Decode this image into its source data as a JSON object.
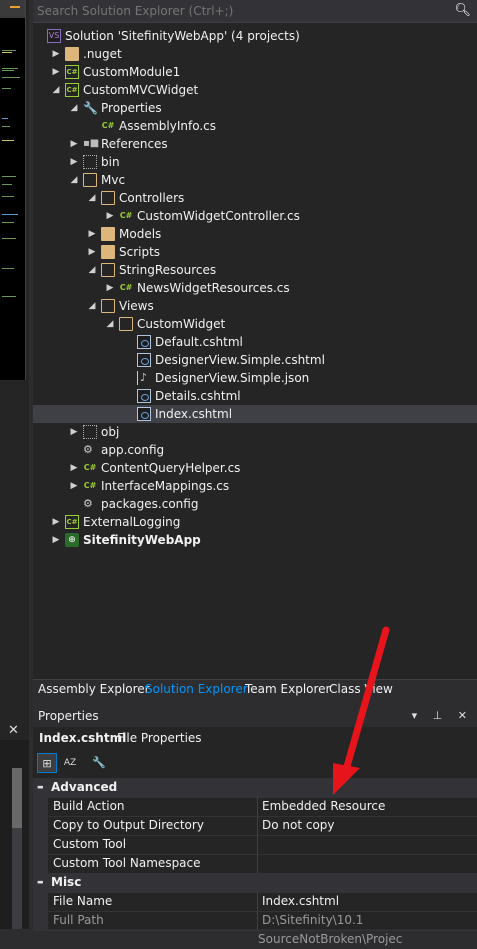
{
  "search": {
    "placeholder": "Search Solution Explorer (Ctrl+;)"
  },
  "tree": [
    {
      "label": "Solution 'SitefinityWebApp' (4 projects)",
      "indent": 0,
      "arrow": "",
      "icon": "vs-sol",
      "iconText": "VS",
      "bold": false
    },
    {
      "label": ".nuget",
      "indent": 1,
      "arrow": "▶",
      "icon": "folder",
      "bold": false
    },
    {
      "label": "CustomModule1",
      "indent": 1,
      "arrow": "▶",
      "icon": "cs-proj",
      "iconText": "C#",
      "bold": false
    },
    {
      "label": "CustomMVCWidget",
      "indent": 1,
      "arrow": "◢",
      "icon": "cs-proj",
      "iconText": "C#",
      "bold": false
    },
    {
      "label": "Properties",
      "indent": 2,
      "arrow": "◢",
      "icon": "wrench",
      "iconText": "🔧",
      "bold": false
    },
    {
      "label": "AssemblyInfo.cs",
      "indent": 3,
      "arrow": "",
      "icon": "cs-file",
      "iconText": "C#",
      "bold": false
    },
    {
      "label": "References",
      "indent": 2,
      "arrow": "▶",
      "icon": "refs",
      "iconText": "▪■",
      "bold": false
    },
    {
      "label": "bin",
      "indent": 2,
      "arrow": "▶",
      "icon": "folder-dots",
      "bold": false
    },
    {
      "label": "Mvc",
      "indent": 2,
      "arrow": "◢",
      "icon": "folder open",
      "bold": false
    },
    {
      "label": "Controllers",
      "indent": 3,
      "arrow": "◢",
      "icon": "folder open",
      "bold": false
    },
    {
      "label": "CustomWidgetController.cs",
      "indent": 4,
      "arrow": "▶",
      "icon": "cs-file",
      "iconText": "C#",
      "bold": false
    },
    {
      "label": "Models",
      "indent": 3,
      "arrow": "▶",
      "icon": "folder",
      "bold": false
    },
    {
      "label": "Scripts",
      "indent": 3,
      "arrow": "▶",
      "icon": "folder",
      "bold": false
    },
    {
      "label": "StringResources",
      "indent": 3,
      "arrow": "◢",
      "icon": "folder open",
      "bold": false
    },
    {
      "label": "NewsWidgetResources.cs",
      "indent": 4,
      "arrow": "▶",
      "icon": "cs-file",
      "iconText": "C#",
      "bold": false
    },
    {
      "label": "Views",
      "indent": 3,
      "arrow": "◢",
      "icon": "folder open",
      "bold": false
    },
    {
      "label": "CustomWidget",
      "indent": 4,
      "arrow": "◢",
      "icon": "folder open",
      "bold": false
    },
    {
      "label": "Default.cshtml",
      "indent": 5,
      "arrow": "",
      "icon": "file-doc",
      "bold": false
    },
    {
      "label": "DesignerView.Simple.cshtml",
      "indent": 5,
      "arrow": "",
      "icon": "file-doc",
      "bold": false
    },
    {
      "label": "DesignerView.Simple.json",
      "indent": 5,
      "arrow": "",
      "icon": "json-icon",
      "bold": false
    },
    {
      "label": "Details.cshtml",
      "indent": 5,
      "arrow": "",
      "icon": "file-doc",
      "bold": false
    },
    {
      "label": "Index.cshtml",
      "indent": 5,
      "arrow": "",
      "icon": "file-doc",
      "bold": false,
      "selected": true
    },
    {
      "label": "obj",
      "indent": 2,
      "arrow": "▶",
      "icon": "folder-dots",
      "bold": false
    },
    {
      "label": "app.config",
      "indent": 2,
      "arrow": "",
      "icon": "config",
      "iconText": "⚙",
      "bold": false
    },
    {
      "label": "ContentQueryHelper.cs",
      "indent": 2,
      "arrow": "▶",
      "icon": "cs-file",
      "iconText": "C#",
      "bold": false
    },
    {
      "label": "InterfaceMappings.cs",
      "indent": 2,
      "arrow": "▶",
      "icon": "cs-file",
      "iconText": "C#",
      "bold": false
    },
    {
      "label": "packages.config",
      "indent": 2,
      "arrow": "",
      "icon": "config",
      "iconText": "⚙",
      "bold": false
    },
    {
      "label": "ExternalLogging",
      "indent": 1,
      "arrow": "▶",
      "icon": "cs-proj",
      "iconText": "C#",
      "bold": false
    },
    {
      "label": "SitefinityWebApp",
      "indent": 1,
      "arrow": "▶",
      "icon": "web-proj",
      "iconText": "⊕",
      "bold": true
    }
  ],
  "tabs": {
    "assembly": "Assembly Explorer",
    "solution": "Solution Explorer",
    "team": "Team Explorer",
    "classview": "Class View"
  },
  "properties": {
    "title": "Properties",
    "header_icons": "▾ ⊥ ✕",
    "object_name": "Index.cshtml",
    "object_type": "File Properties",
    "toolbar": {
      "categorized": "⊞",
      "alphabetical": "AZ",
      "property_pages": "🔧"
    },
    "categories": [
      {
        "name": "Advanced",
        "rows": [
          {
            "name": "Build Action",
            "value": "Embedded Resource"
          },
          {
            "name": "Copy to Output Directory",
            "value": "Do not copy"
          },
          {
            "name": "Custom Tool",
            "value": ""
          },
          {
            "name": "Custom Tool Namespace",
            "value": ""
          }
        ]
      },
      {
        "name": "Misc",
        "rows": [
          {
            "name": "File Name",
            "value": "Index.cshtml"
          },
          {
            "name": "Full Path",
            "value": "D:\\Sitefinity\\10.1 SourceNotBroken\\Projec",
            "disabled": true
          }
        ]
      }
    ]
  },
  "left": {
    "close": "✕"
  },
  "colors": {
    "accent": "#0097fb",
    "annotation_arrow": "#e8141b"
  }
}
